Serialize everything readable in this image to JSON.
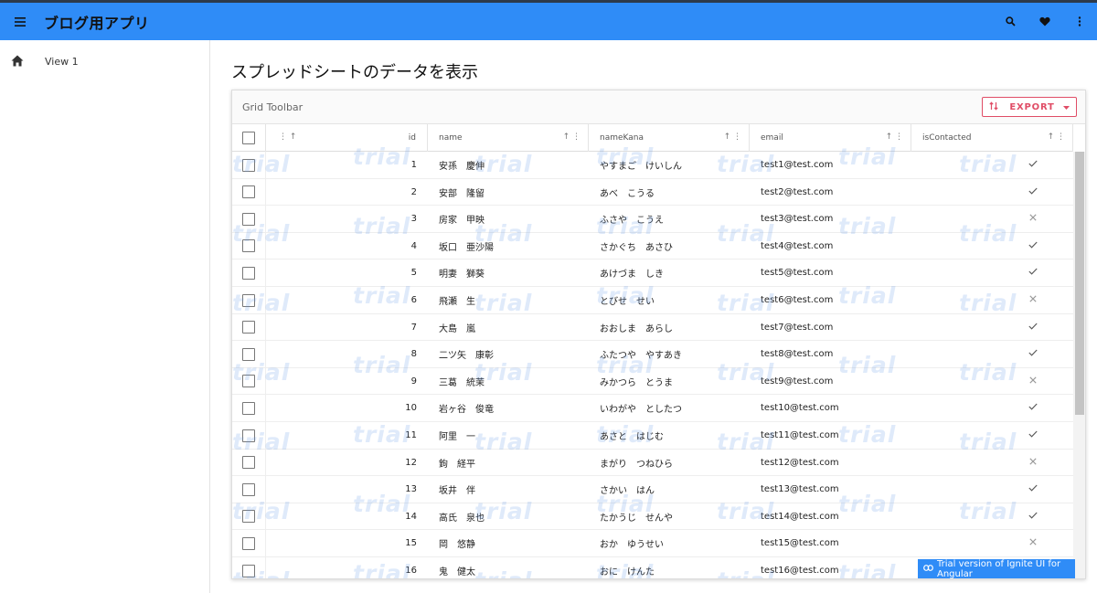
{
  "app": {
    "title": "ブログ用アプリ"
  },
  "appbar": {
    "icons": [
      "menu-icon",
      "search-icon",
      "heart-icon",
      "more-vert-icon"
    ]
  },
  "sidenav": {
    "items": [
      {
        "icon": "home-icon",
        "label": "View 1"
      }
    ]
  },
  "page": {
    "title": "スプレッドシートのデータを表示"
  },
  "grid": {
    "toolbar_title": "Grid Toolbar",
    "export_label": "EXPORT",
    "columns": [
      {
        "key": "select",
        "label": ""
      },
      {
        "key": "id",
        "label": "id"
      },
      {
        "key": "name",
        "label": "name"
      },
      {
        "key": "nameKana",
        "label": "nameKana"
      },
      {
        "key": "email",
        "label": "email"
      },
      {
        "key": "isContacted",
        "label": "isContacted"
      }
    ],
    "rows": [
      {
        "id": "1",
        "name": "安孫　慶伸",
        "nameKana": "やすまご　けいしん",
        "email": "test1@test.com",
        "isContacted": true
      },
      {
        "id": "2",
        "name": "安部　隆留",
        "nameKana": "あべ　こうる",
        "email": "test2@test.com",
        "isContacted": true
      },
      {
        "id": "3",
        "name": "房家　甲映",
        "nameKana": "ふさや　こうえ",
        "email": "test3@test.com",
        "isContacted": false
      },
      {
        "id": "4",
        "name": "坂口　亜沙陽",
        "nameKana": "さかぐち　あさひ",
        "email": "test4@test.com",
        "isContacted": true
      },
      {
        "id": "5",
        "name": "明妻　獅葵",
        "nameKana": "あけづま　しき",
        "email": "test5@test.com",
        "isContacted": true
      },
      {
        "id": "6",
        "name": "飛瀬　生",
        "nameKana": "とびせ　せい",
        "email": "test6@test.com",
        "isContacted": false
      },
      {
        "id": "7",
        "name": "大島　嵐",
        "nameKana": "おおしま　あらし",
        "email": "test7@test.com",
        "isContacted": true
      },
      {
        "id": "8",
        "name": "二ツ矢　康彰",
        "nameKana": "ふたつや　やすあき",
        "email": "test8@test.com",
        "isContacted": true
      },
      {
        "id": "9",
        "name": "三葛　統茉",
        "nameKana": "みかつら　とうま",
        "email": "test9@test.com",
        "isContacted": false
      },
      {
        "id": "10",
        "name": "岩ヶ谷　俊竜",
        "nameKana": "いわがや　としたつ",
        "email": "test10@test.com",
        "isContacted": true
      },
      {
        "id": "11",
        "name": "阿里　一",
        "nameKana": "あさと　はじむ",
        "email": "test11@test.com",
        "isContacted": true
      },
      {
        "id": "12",
        "name": "鉤　経平",
        "nameKana": "まがり　つねひら",
        "email": "test12@test.com",
        "isContacted": false
      },
      {
        "id": "13",
        "name": "坂井　伴",
        "nameKana": "さかい　はん",
        "email": "test13@test.com",
        "isContacted": true
      },
      {
        "id": "14",
        "name": "高氏　泉也",
        "nameKana": "たかうじ　せんや",
        "email": "test14@test.com",
        "isContacted": true
      },
      {
        "id": "15",
        "name": "岡　悠静",
        "nameKana": "おか　ゆうせい",
        "email": "test15@test.com",
        "isContacted": false
      },
      {
        "id": "16",
        "name": "鬼　健太",
        "nameKana": "おに　けんた",
        "email": "test16@test.com",
        "isContacted": false
      }
    ],
    "watermark": "trial",
    "trial_banner": "Trial version of Ignite UI for Angular"
  }
}
